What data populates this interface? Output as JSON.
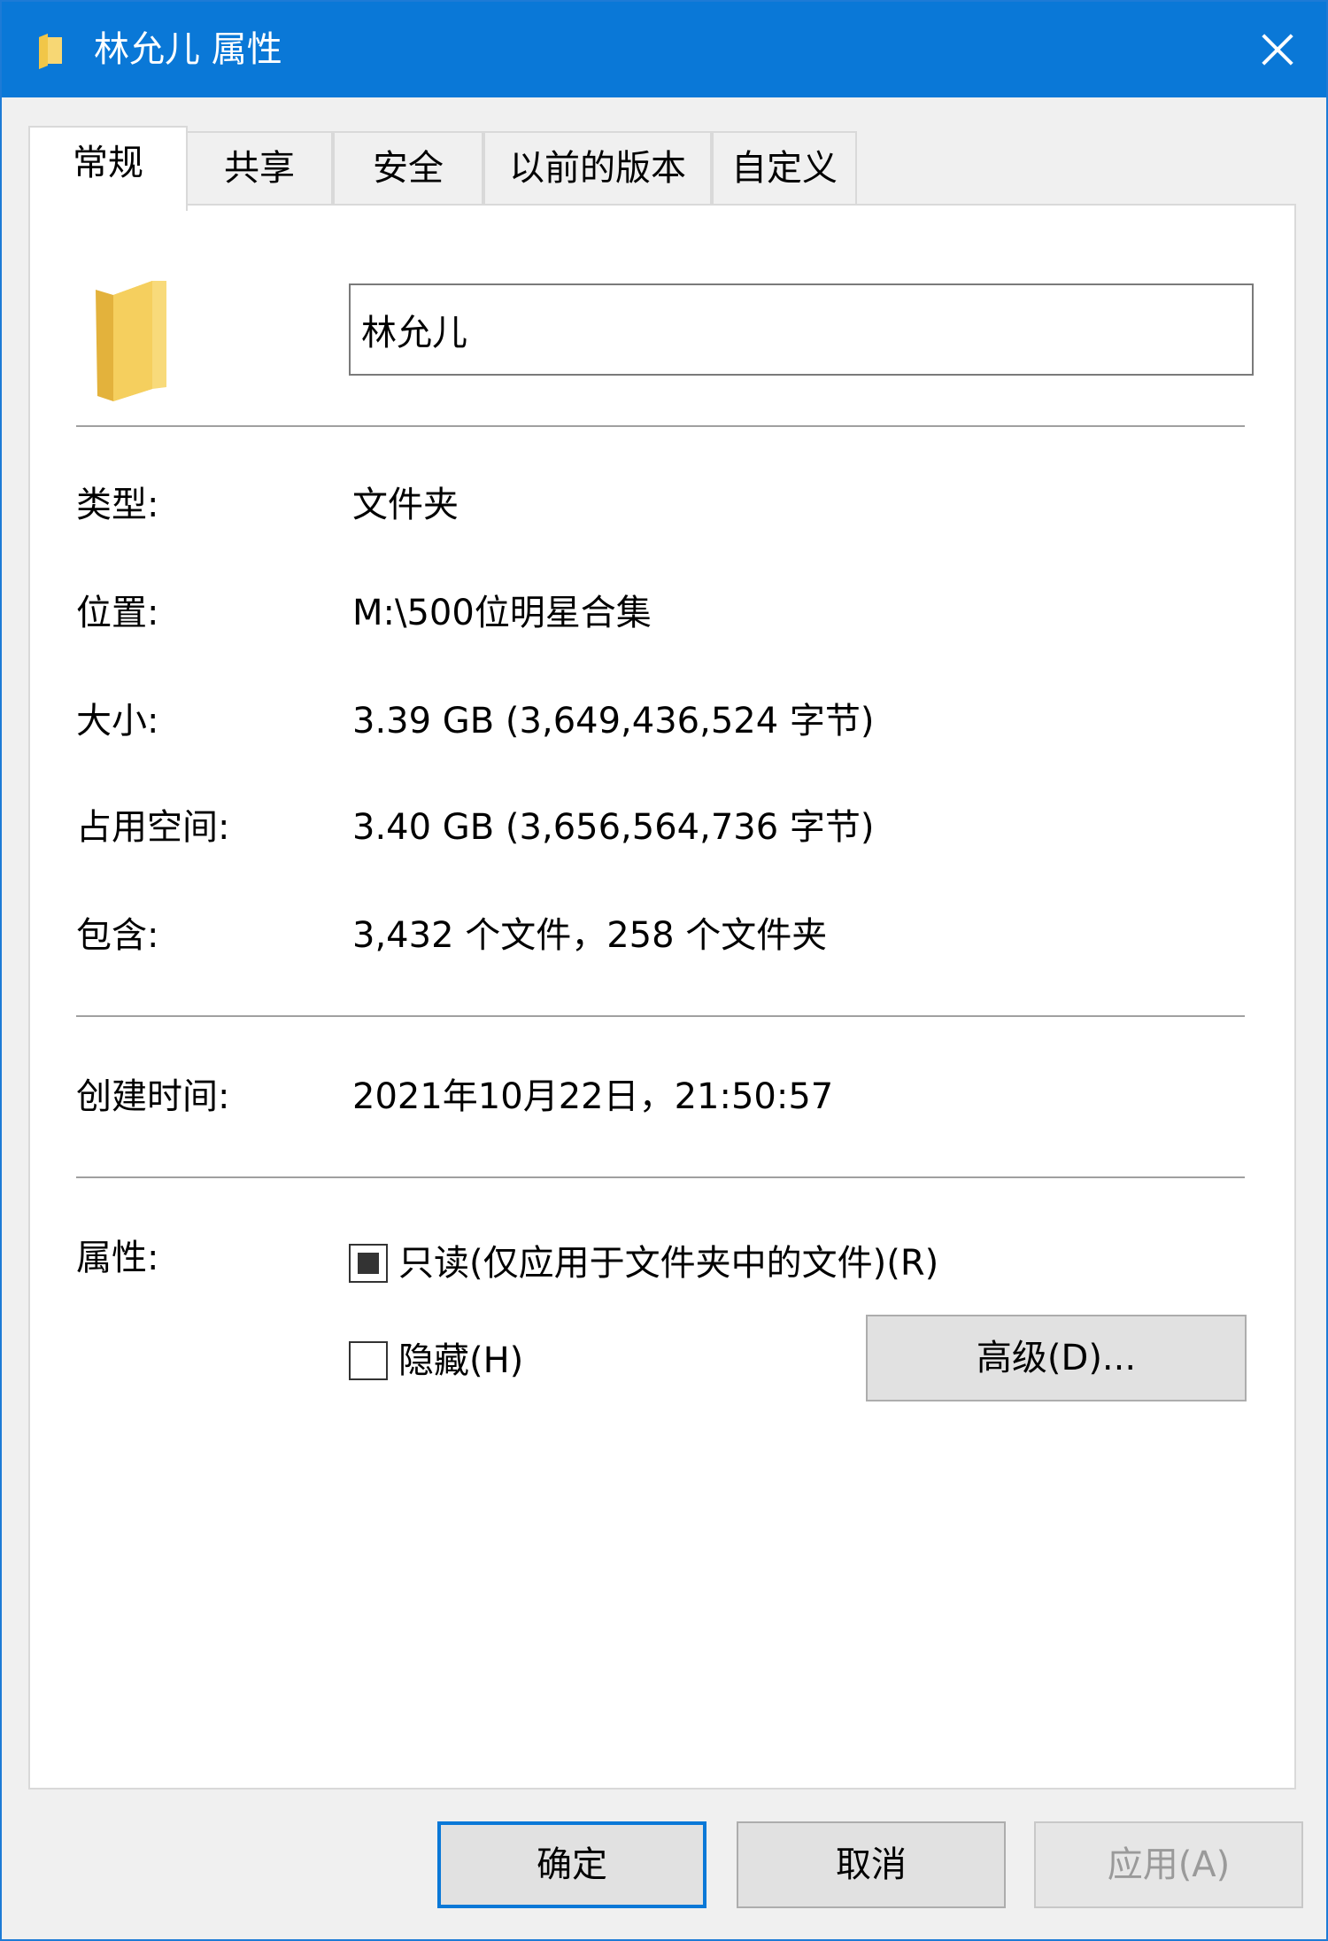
{
  "window": {
    "title": "林允儿 属性"
  },
  "tabs": [
    {
      "label": "常规"
    },
    {
      "label": "共享"
    },
    {
      "label": "安全"
    },
    {
      "label": "以前的版本"
    },
    {
      "label": "自定义"
    }
  ],
  "general": {
    "name_value": "林允儿",
    "rows": [
      {
        "label": "类型:",
        "value": "文件夹"
      },
      {
        "label": "位置:",
        "value": "M:\\500位明星合集"
      },
      {
        "label": "大小:",
        "value": "3.39 GB (3,649,436,524 字节)"
      },
      {
        "label": "占用空间:",
        "value": "3.40 GB (3,656,564,736 字节)"
      },
      {
        "label": "包含:",
        "value": "3,432 个文件，258 个文件夹"
      },
      {
        "label": "创建时间:",
        "value": "2021年10月22日，21:50:57"
      }
    ],
    "attributes_label": "属性:",
    "readonly_label": "只读(仅应用于文件夹中的文件)(R)",
    "hidden_label": "隐藏(H)",
    "advanced_button": "高级(D)..."
  },
  "footer": {
    "ok": "确定",
    "cancel": "取消",
    "apply": "应用(A)"
  },
  "colors": {
    "titlebar": "#0a78d7",
    "folder": "#f5c542"
  },
  "icons": {
    "title": "folder-icon",
    "big": "folder-icon",
    "close": "close-icon"
  }
}
